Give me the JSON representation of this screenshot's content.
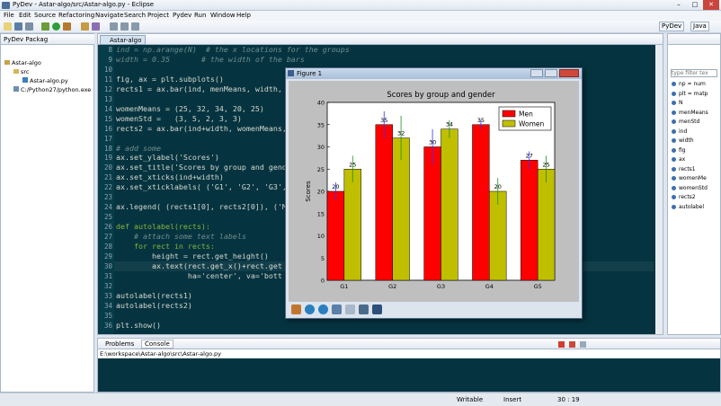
{
  "window": {
    "title": "PyDev - Astar-algo/src/Astar-algo.py - Eclipse",
    "min": "–",
    "max": "□",
    "close": "✕"
  },
  "menu": [
    "File",
    "Edit",
    "Source",
    "Refactoring",
    "Navigate",
    "Search",
    "Project",
    "Pydev",
    "Run",
    "Window",
    "Help"
  ],
  "perspectives": {
    "pydev": "PyDev",
    "java": "Java"
  },
  "package_explorer": {
    "tab": "PyDev Packag",
    "tree": [
      "Astar-algo",
      "src",
      "Astar-algo.py",
      "C:/Python27/python.exe"
    ]
  },
  "editor": {
    "tab": "Astar-algo",
    "lines": [
      {
        "n": "8",
        "text": "ind = np.arange(N)  # the x locations for the groups",
        "type": "cmt"
      },
      {
        "n": "9",
        "text": "width = 0.35       # the width of the bars",
        "type": "cmt"
      },
      {
        "n": "10",
        "text": "",
        "type": "code"
      },
      {
        "n": "11",
        "text": "fig, ax = plt.subplots()",
        "type": "code"
      },
      {
        "n": "12",
        "text": "rects1 = ax.bar(ind, menMeans, width, ",
        "type": "code"
      },
      {
        "n": "13",
        "text": "",
        "type": "code"
      },
      {
        "n": "14",
        "text": "womenMeans = (25, 32, 34, 20, 25)",
        "type": "code"
      },
      {
        "n": "15",
        "text": "womenStd =   (3, 5, 2, 3, 3)",
        "type": "code"
      },
      {
        "n": "16",
        "text": "rects2 = ax.bar(ind+width, womenMeans,",
        "type": "code"
      },
      {
        "n": "17",
        "text": "",
        "type": "code"
      },
      {
        "n": "18",
        "text": "# add some",
        "type": "cmt"
      },
      {
        "n": "19",
        "text": "ax.set_ylabel('Scores')",
        "type": "code"
      },
      {
        "n": "20",
        "text": "ax.set_title('Scores by group and gende",
        "type": "code"
      },
      {
        "n": "21",
        "text": "ax.set_xticks(ind+width)",
        "type": "code"
      },
      {
        "n": "22",
        "text": "ax.set_xticklabels( ('G1', 'G2', 'G3',",
        "type": "code"
      },
      {
        "n": "23",
        "text": "",
        "type": "code"
      },
      {
        "n": "24",
        "text": "ax.legend( (rects1[0], rects2[0]), ('M",
        "type": "code"
      },
      {
        "n": "25",
        "text": "",
        "type": "code"
      },
      {
        "n": "26",
        "text": "def autolabel(rects):",
        "type": "kw"
      },
      {
        "n": "27",
        "text": "    # attach some text labels",
        "type": "cmt"
      },
      {
        "n": "28",
        "text": "    for rect in rects:",
        "type": "kw"
      },
      {
        "n": "29",
        "text": "        height = rect.get_height()",
        "type": "code"
      },
      {
        "n": "30",
        "text": "        ax.text(rect.get_x()+rect.get",
        "type": "code"
      },
      {
        "n": "31",
        "text": "                ha='center', va='bott",
        "type": "code"
      },
      {
        "n": "32",
        "text": "",
        "type": "code"
      },
      {
        "n": "33",
        "text": "autolabel(rects1)",
        "type": "code"
      },
      {
        "n": "34",
        "text": "autolabel(rects2)",
        "type": "code"
      },
      {
        "n": "35",
        "text": "",
        "type": "code"
      },
      {
        "n": "36",
        "text": "plt.show()",
        "type": "code"
      }
    ]
  },
  "outline": {
    "filter_placeholder": "type filter tex",
    "items": [
      "np = num",
      "plt = matp",
      "N",
      "menMeans",
      "menStd",
      "ind",
      "width",
      "fig",
      "ax",
      "rects1",
      "womenMe",
      "womenStd",
      "rects2",
      "autolabel"
    ]
  },
  "console": {
    "tabs": {
      "problems": "Problems",
      "console": "Console"
    },
    "path": "E:\\workspace\\Astar-algo\\src\\Astar-algo.py"
  },
  "status": {
    "mode": "Writable",
    "insert": "Insert",
    "position": "30 : 19"
  },
  "figure": {
    "title": "Figure 1"
  },
  "chart_data": {
    "type": "bar",
    "title": "Scores by group and gender",
    "ylabel": "Scores",
    "xlabel": "",
    "categories": [
      "G1",
      "G2",
      "G3",
      "G4",
      "G5"
    ],
    "ylim": [
      0,
      40
    ],
    "yticks": [
      0,
      5,
      10,
      15,
      20,
      25,
      30,
      35,
      40
    ],
    "legend_position": "top-right",
    "series": [
      {
        "name": "Men",
        "values": [
          20,
          35,
          30,
          35,
          27
        ],
        "errors": [
          2,
          3,
          4,
          1,
          2
        ],
        "labels": [
          "20",
          "35",
          "30",
          "35",
          "27"
        ],
        "color": "#ff0000",
        "err_color": "#3333ff"
      },
      {
        "name": "Women",
        "values": [
          25,
          32,
          34,
          20,
          25
        ],
        "errors": [
          3,
          5,
          2,
          3,
          3
        ],
        "labels": [
          "25",
          "32",
          "34",
          "20",
          "25"
        ],
        "color": "#bfbf00",
        "err_color": "#1f8f1f"
      }
    ]
  }
}
